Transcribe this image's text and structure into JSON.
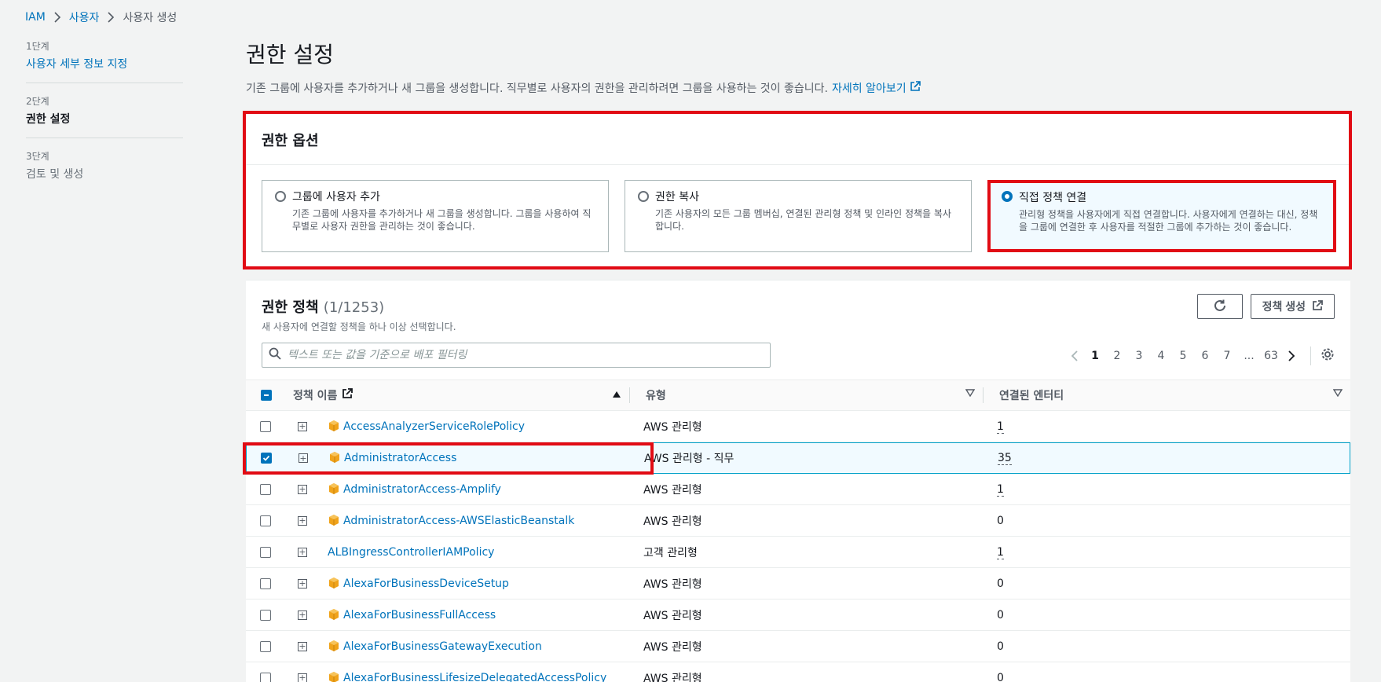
{
  "breadcrumb": {
    "items": [
      "IAM",
      "사용자"
    ],
    "current": "사용자 생성"
  },
  "steps": [
    {
      "num": "1단계",
      "title": "사용자 세부 정보 지정",
      "state": "link"
    },
    {
      "num": "2단계",
      "title": "권한 설정",
      "state": "active"
    },
    {
      "num": "3단계",
      "title": "검토 및 생성",
      "state": "disabled"
    }
  ],
  "page": {
    "title": "권한 설정",
    "description": "기존 그룹에 사용자를 추가하거나 새 그룹을 생성합니다. 직무별로 사용자의 권한을 관리하려면 그룹을 사용하는 것이 좋습니다.",
    "learn_more": "자세히 알아보기"
  },
  "options": {
    "title": "권한 옵션",
    "cards": [
      {
        "title": "그룹에 사용자 추가",
        "desc": "기존 그룹에 사용자를 추가하거나 새 그룹을 생성합니다. 그룹을 사용하여 직무별로 사용자 권한을 관리하는 것이 좋습니다.",
        "selected": false
      },
      {
        "title": "권한 복사",
        "desc": "기존 사용자의 모든 그룹 멤버십, 연결된 관리형 정책 및 인라인 정책을 복사합니다.",
        "selected": false
      },
      {
        "title": "직접 정책 연결",
        "desc": "관리형 정책을 사용자에게 직접 연결합니다. 사용자에게 연결하는 대신, 정책을 그룹에 연결한 후 사용자를 적절한 그룹에 추가하는 것이 좋습니다.",
        "selected": true
      }
    ]
  },
  "policies": {
    "title": "권한 정책",
    "count": "(1/1253)",
    "subtitle": "새 사용자에 연결할 정책을 하나 이상 선택합니다.",
    "create_button": "정책 생성",
    "filter_placeholder": "텍스트 또는 값을 기준으로 배포 필터링",
    "pagination": {
      "pages": [
        "1",
        "2",
        "3",
        "4",
        "5",
        "6",
        "7",
        "...",
        "63"
      ],
      "current": "1"
    },
    "columns": {
      "name": "정책 이름",
      "type": "유형",
      "entities": "연결된 엔터티"
    },
    "rows": [
      {
        "name": "AccessAnalyzerServiceRolePolicy",
        "type": "AWS 관리형",
        "entities": "1",
        "checked": false,
        "icon": true,
        "entity_link": true
      },
      {
        "name": "AdministratorAccess",
        "type": "AWS 관리형 - 직무",
        "entities": "35",
        "checked": true,
        "icon": true,
        "entity_link": true
      },
      {
        "name": "AdministratorAccess-Amplify",
        "type": "AWS 관리형",
        "entities": "1",
        "checked": false,
        "icon": true,
        "entity_link": true
      },
      {
        "name": "AdministratorAccess-AWSElasticBeanstalk",
        "type": "AWS 관리형",
        "entities": "0",
        "checked": false,
        "icon": true,
        "entity_link": false
      },
      {
        "name": "ALBIngressControllerIAMPolicy",
        "type": "고객 관리형",
        "entities": "1",
        "checked": false,
        "icon": false,
        "entity_link": true
      },
      {
        "name": "AlexaForBusinessDeviceSetup",
        "type": "AWS 관리형",
        "entities": "0",
        "checked": false,
        "icon": true,
        "entity_link": false
      },
      {
        "name": "AlexaForBusinessFullAccess",
        "type": "AWS 관리형",
        "entities": "0",
        "checked": false,
        "icon": true,
        "entity_link": false
      },
      {
        "name": "AlexaForBusinessGatewayExecution",
        "type": "AWS 관리형",
        "entities": "0",
        "checked": false,
        "icon": true,
        "entity_link": false
      },
      {
        "name": "AlexaForBusinessLifesizeDelegatedAccessPolicy",
        "type": "AWS 관리형",
        "entities": "0",
        "checked": false,
        "icon": true,
        "entity_link": false
      }
    ]
  },
  "colors": {
    "link": "#0073bb",
    "highlight": "#e10b14",
    "package_icon": "#f0a31b"
  }
}
